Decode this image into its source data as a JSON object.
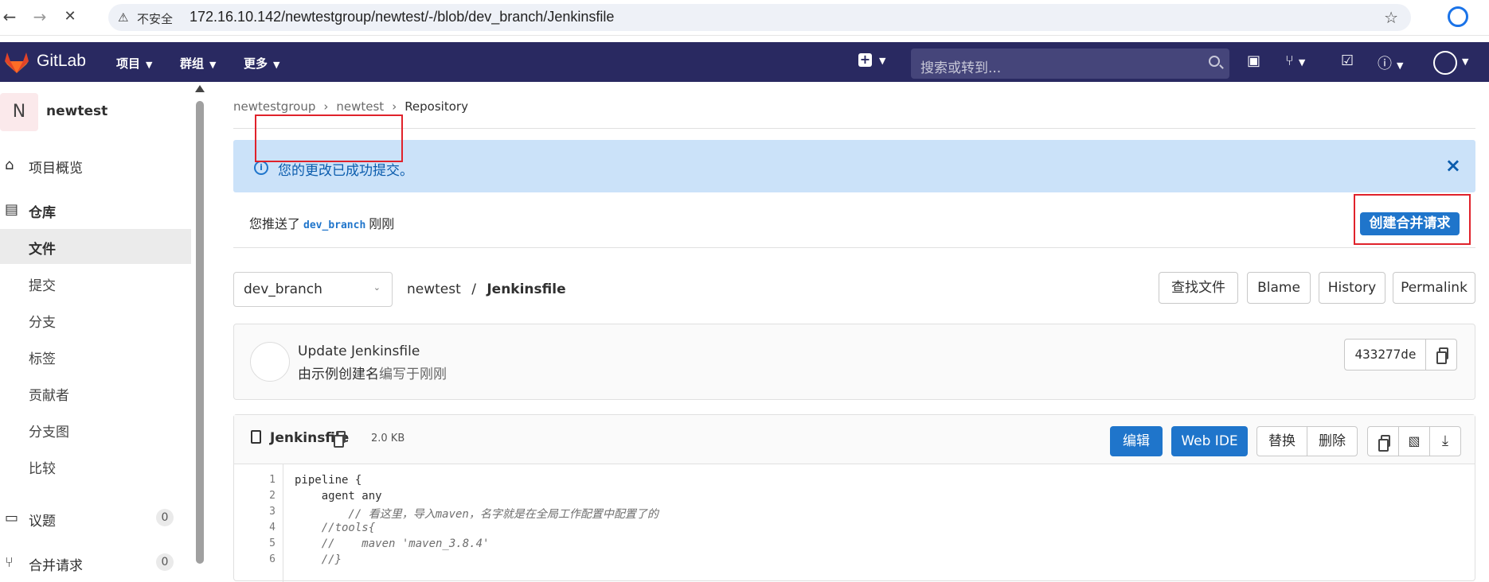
{
  "browser": {
    "insecure_label": "不安全",
    "url": "172.16.10.142/newtestgroup/newtest/-/blob/dev_branch/Jenkinsfile"
  },
  "topnav": {
    "brand": "GitLab",
    "items": [
      {
        "label": "项目"
      },
      {
        "label": "群组"
      },
      {
        "label": "更多"
      }
    ],
    "search_placeholder": "搜索或转到..."
  },
  "sidebar": {
    "project_initial": "N",
    "project_name": "newtest",
    "overview": "项目概览",
    "repository": "仓库",
    "repo_items": [
      {
        "label": "文件"
      },
      {
        "label": "提交"
      },
      {
        "label": "分支"
      },
      {
        "label": "标签"
      },
      {
        "label": "贡献者"
      },
      {
        "label": "分支图"
      },
      {
        "label": "比较"
      }
    ],
    "issues": {
      "label": "议题",
      "count": "0"
    },
    "merge_requests": {
      "label": "合并请求",
      "count": "0"
    }
  },
  "breadcrumb": [
    "newtestgroup",
    "newtest",
    "Repository"
  ],
  "alert": {
    "message": "您的更改已成功提交。"
  },
  "push_notice": {
    "prefix": "您推送了",
    "branch": "dev_branch",
    "suffix": "刚刚",
    "button": "创建合并请求"
  },
  "file_nav": {
    "branch": "dev_branch",
    "project": "newtest",
    "sep": "/",
    "file": "Jenkinsfile",
    "buttons": [
      {
        "label": "查找文件"
      },
      {
        "label": "Blame"
      },
      {
        "label": "History"
      },
      {
        "label": "Permalink"
      }
    ]
  },
  "commit": {
    "title": "Update Jenkinsfile",
    "author_prefix": "由",
    "author": "示例创建名",
    "time": "编写于刚刚",
    "sha": "433277de"
  },
  "file": {
    "name": "Jenkinsfile",
    "size": "2.0 KB",
    "buttons": {
      "edit": "编辑",
      "webide": "Web IDE",
      "replace": "替换",
      "delete": "删除"
    },
    "lines": [
      {
        "n": "1",
        "text": "pipeline {"
      },
      {
        "n": "2",
        "text": "    agent any"
      },
      {
        "n": "3",
        "text": "        // 看这里，导入maven，名字就是在全局工作配置中配置了的"
      },
      {
        "n": "4",
        "text": "    //tools{"
      },
      {
        "n": "5",
        "text": "    //    maven 'maven_3.8.4'"
      },
      {
        "n": "6",
        "text": "    //}"
      }
    ]
  },
  "colors": {
    "navbar": "#292961",
    "accent": "#1f75cb",
    "alert_bg": "#cbe2f9",
    "highlight": "#e0222b"
  }
}
